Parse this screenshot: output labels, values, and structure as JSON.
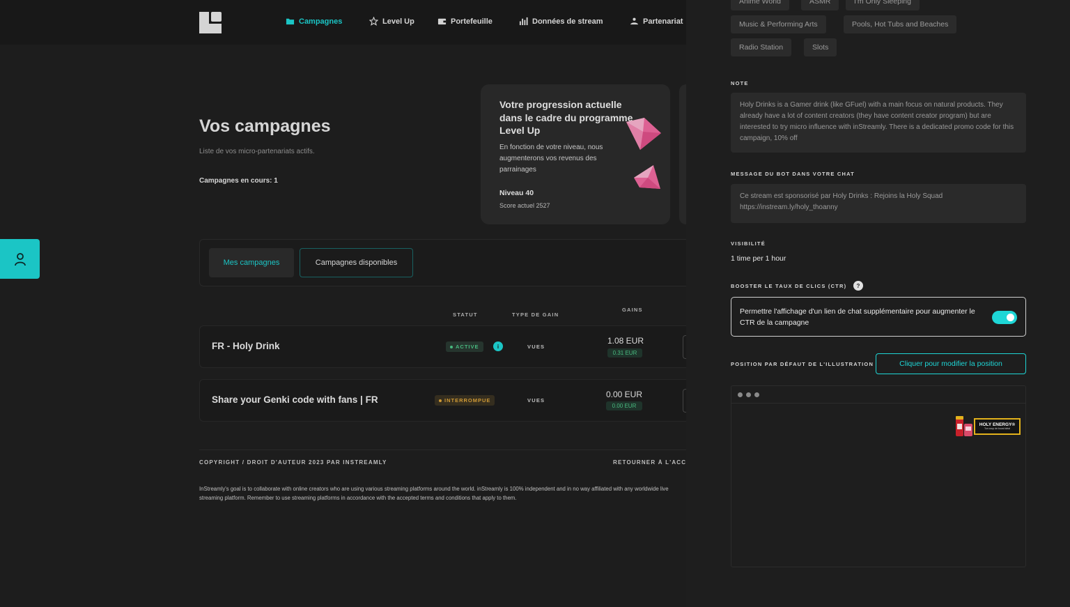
{
  "nav": {
    "items": [
      {
        "label": "Campagnes",
        "icon": "folder-icon"
      },
      {
        "label": "Level Up",
        "icon": "star-icon"
      },
      {
        "label": "Portefeuille",
        "icon": "wallet-icon"
      },
      {
        "label": "Données de stream",
        "icon": "bar-chart-icon"
      },
      {
        "label": "Partenariat",
        "icon": "handshake-icon"
      }
    ]
  },
  "main": {
    "title": "Vos campagnes",
    "subtitle": "Liste de vos micro-partenariats actifs.",
    "count_label": "Campagnes en cours: 1"
  },
  "promo": {
    "title": "Votre progression actuelle dans le cadre du programme Level Up",
    "description": "En fonction de votre niveau, nous augmenterons vos revenus des parrainages",
    "level": "Niveau 40",
    "score": "Score actuel 2527"
  },
  "tabs": {
    "mine": "Mes campagnes",
    "available": "Campagnes disponibles"
  },
  "table": {
    "headers": {
      "status": "STATUT",
      "gain_type": "TYPE DE GAIN",
      "earnings": "GAINS"
    },
    "rows": [
      {
        "name": "FR - Holy Drink",
        "status": "ACTIVE",
        "info": "i",
        "gain_type": "VUES",
        "amount": "1.08 EUR",
        "sub_amount": "0.31 EUR"
      },
      {
        "name": "Share your Genki code with fans | FR",
        "status": "INTERROMPUE",
        "gain_type": "VUES",
        "amount": "0.00 EUR",
        "sub_amount": "0.00 EUR"
      }
    ]
  },
  "footer": {
    "copyright": "COPYRIGHT / DROIT D'AUTEUR 2023 PAR INSTREAMLY",
    "back": "RETOURNER À L'ACCUEIL",
    "disclaimer": "InStreamly's goal is to collaborate with online creators who are using various streaming platforms around the world. inStreamly is 100% independent and in no way affiliated with any worldwide live streaming platform. Remember to use streaming platforms in accordance with the accepted terms and conditions that apply to them."
  },
  "drawer": {
    "categories_row0": [
      "Anime World",
      "ASMR",
      "I'm Only Sleeping"
    ],
    "categories_row1": [
      "Music & Performing Arts",
      "Pools, Hot Tubs and Beaches"
    ],
    "categories_row2": [
      "Radio Station",
      "Slots"
    ],
    "note_label": "NOTE",
    "note": "Holy Drinks is a Gamer drink (like GFuel) with a main focus on natural products. They already have a lot of content creators (they have content creator program) but are interested to try micro influence with inStreamly. There is a dedicated promo code for this campaign, 10% off",
    "bot_label": "MESSAGE DU BOT DANS VOTRE CHAT",
    "bot_message": "Ce stream est sponsorisé par Holy Drinks : Rejoins la Holy Squad https://instream.ly/holy_thoanny",
    "visibility_label": "VISIBILITÉ",
    "visibility": "1 time per 1 hour",
    "ctr_label": "BOOSTER LE TAUX DE CLICS (CTR)",
    "ctr_help": "?",
    "ctr_text": "Permettre l'affichage d'un lien de chat supplémentaire pour augmenter le CTR de la campagne",
    "ctr_enabled": true,
    "position_label": "POSITION PAR DÉFAUT DE L'ILLUSTRATION",
    "position_button": "Cliquer pour modifier la position",
    "banner_title": "HOLY ENERGY®",
    "banner_sub": "Ton coup de boost idéal"
  },
  "colors": {
    "accent": "#1ed6d6",
    "background": "#202020",
    "drawer": "#1e1e1e",
    "active": "#4fc98a",
    "paused": "#e0a63a"
  }
}
